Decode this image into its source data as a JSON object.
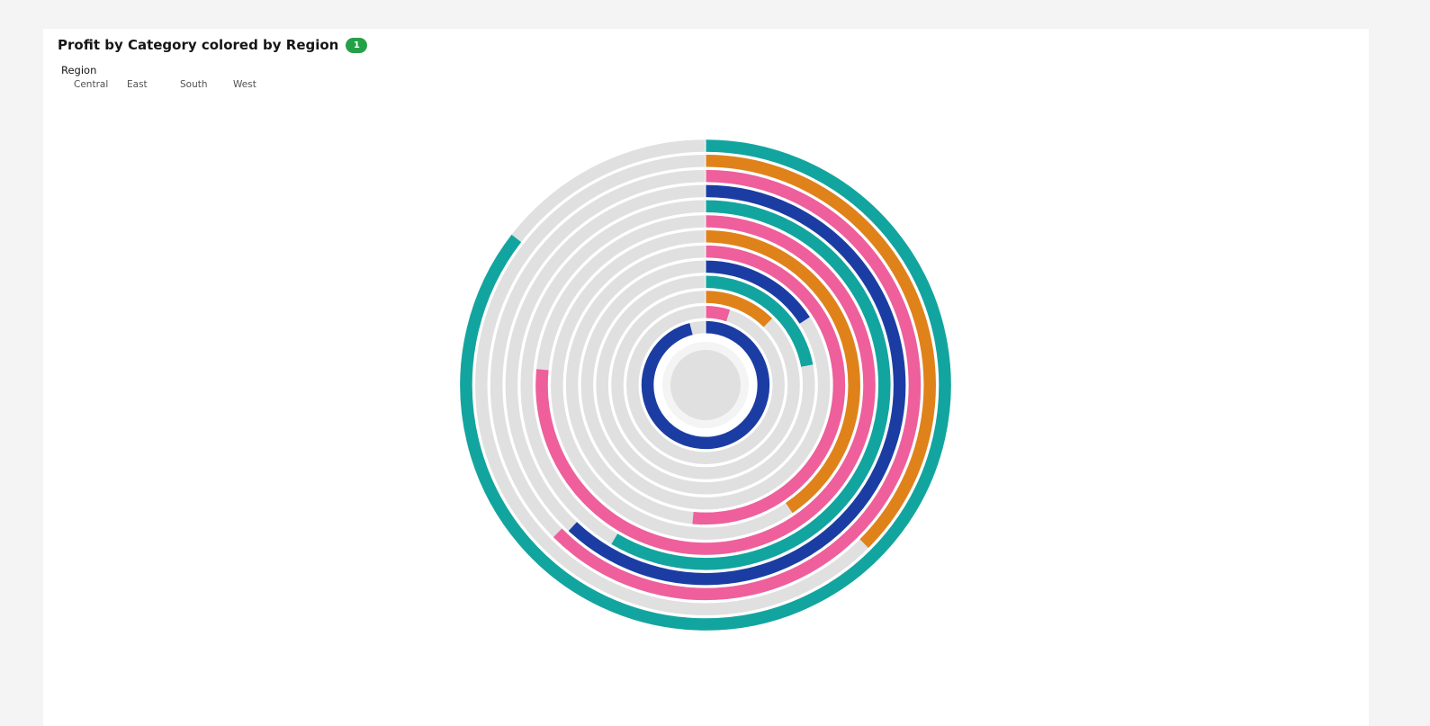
{
  "header": {
    "title": "Profit by Category colored by Region",
    "badge": "1"
  },
  "colors": {
    "track": "#e0e0e0",
    "center": "#e0e0e0",
    "center_ring": "#f4f4f4"
  },
  "chart_data": {
    "type": "radial-bar",
    "title": "Profit by Category colored by Region",
    "legend": {
      "title": "Region",
      "placement": "top-left",
      "items": [
        {
          "name": "Central",
          "color": "#12a59f"
        },
        {
          "name": "East",
          "color": "#e0821a"
        },
        {
          "name": "South",
          "color": "#ee5f9c"
        },
        {
          "name": "West",
          "color": "#1b3da3"
        }
      ]
    },
    "bars": [
      {
        "region": "Central",
        "fraction": 0.855
      },
      {
        "region": "East",
        "fraction": 0.375
      },
      {
        "region": "South",
        "fraction": 0.625
      },
      {
        "region": "West",
        "fraction": 0.62
      },
      {
        "region": "Central",
        "fraction": 0.585
      },
      {
        "region": "South",
        "fraction": 0.765
      },
      {
        "region": "East",
        "fraction": 0.405
      },
      {
        "region": "South",
        "fraction": 0.515
      },
      {
        "region": "West",
        "fraction": 0.158
      },
      {
        "region": "Central",
        "fraction": 0.22
      },
      {
        "region": "East",
        "fraction": 0.125
      },
      {
        "region": "South",
        "fraction": 0.05
      },
      {
        "region": "West",
        "fraction": 0.96
      }
    ]
  }
}
